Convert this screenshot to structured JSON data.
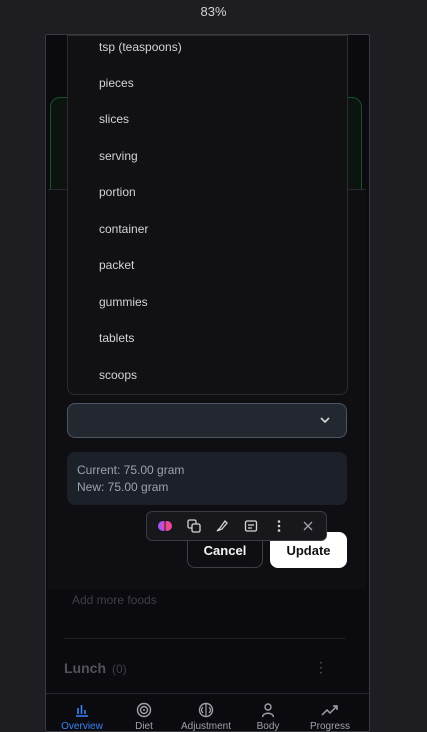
{
  "zoom": "83%",
  "dropdown": {
    "items": [
      "tsp (teaspoons)",
      "pieces",
      "slices",
      "serving",
      "portion",
      "container",
      "packet",
      "gummies",
      "tablets",
      "scoops"
    ]
  },
  "select": {
    "value": ""
  },
  "info": {
    "current": "Current: 75.00 gram",
    "new": "New: 75.00 gram"
  },
  "buttons": {
    "cancel": "Cancel",
    "update": "Update"
  },
  "modal": {
    "close": "×"
  },
  "background": {
    "add_more": "Add more foods",
    "lunch_title": "Lunch",
    "lunch_count": "(0)",
    "lunch_menu": "⋮"
  },
  "nav": {
    "items": [
      {
        "label": "Overview",
        "icon": "bar-chart-icon",
        "active": true
      },
      {
        "label": "Diet",
        "icon": "target-icon",
        "active": false
      },
      {
        "label": "Adjustment",
        "icon": "brain-icon",
        "active": false
      },
      {
        "label": "Body",
        "icon": "person-icon",
        "active": false
      },
      {
        "label": "Progress",
        "icon": "trending-up-icon",
        "active": false
      }
    ]
  },
  "toolbar": {
    "icons": [
      "ai-brain-icon",
      "copy-icon",
      "highlight-icon",
      "note-icon",
      "more-vertical-icon",
      "close-icon"
    ]
  },
  "colors": {
    "accent": "#3b82f6",
    "card_border": "#14532d"
  }
}
